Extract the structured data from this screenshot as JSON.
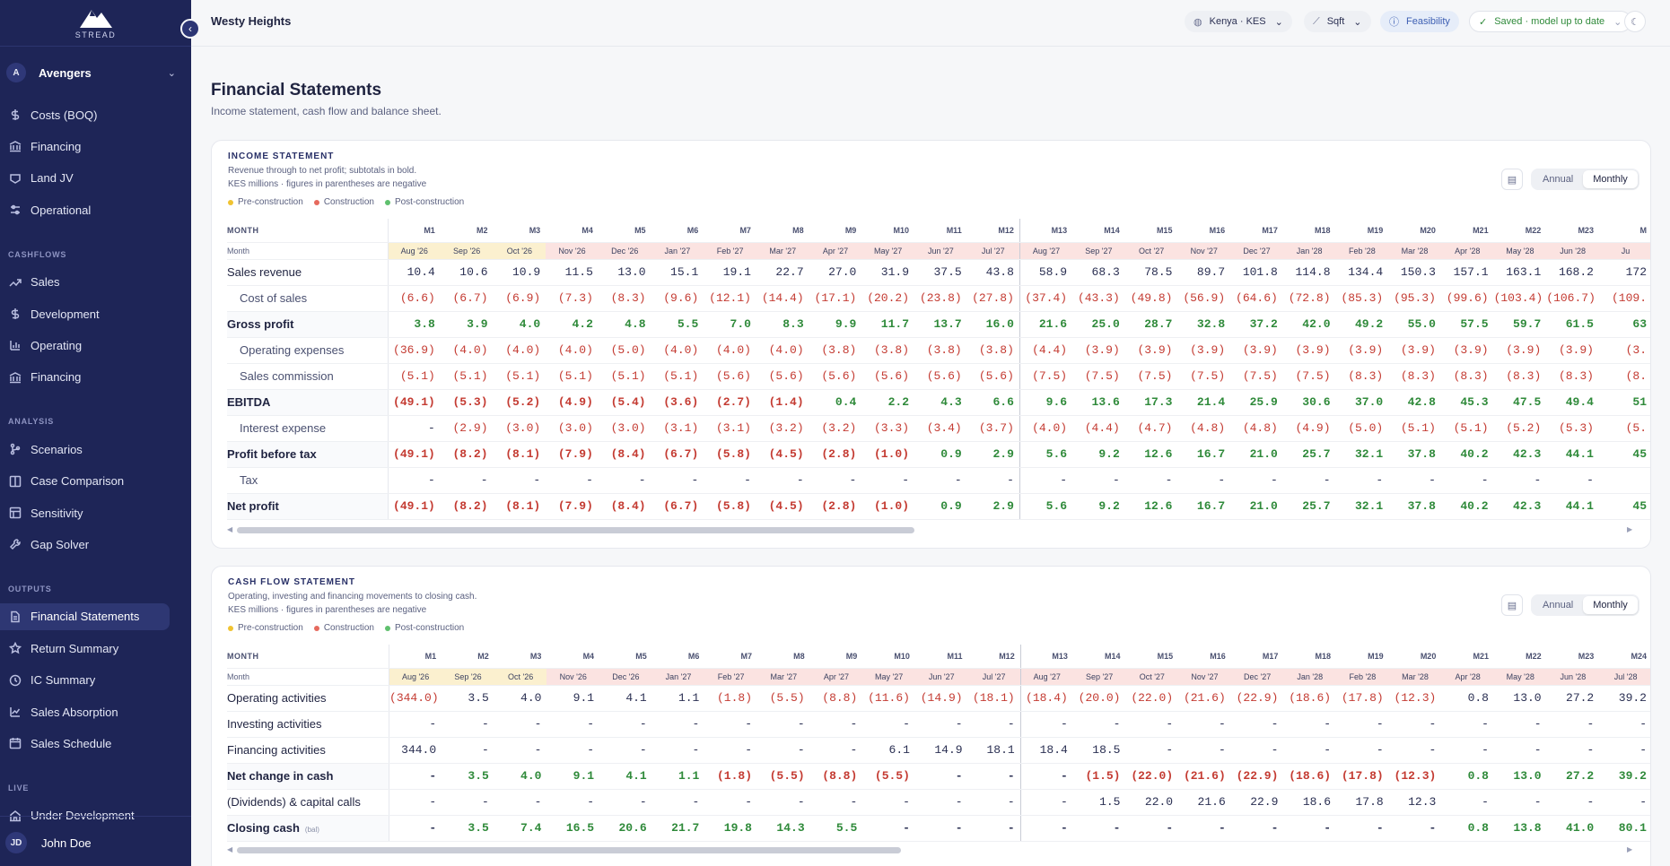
{
  "app": {
    "logo_text": "STREAD",
    "project_title": "Westy Heights"
  },
  "topbar": {
    "region": "Kenya · KES",
    "unit": "Sqft",
    "mode": "Feasibility",
    "status": "Saved · model up to date"
  },
  "sidebar": {
    "workspace_initial": "A",
    "workspace_name": "Avengers",
    "top_items": [
      {
        "label": "Costs (BOQ)",
        "icon": "dollar-icon"
      },
      {
        "label": "Financing",
        "icon": "bank-icon"
      },
      {
        "label": "Land JV",
        "icon": "handshake-icon"
      },
      {
        "label": "Operational",
        "icon": "sliders-icon"
      }
    ],
    "sections": [
      {
        "title": "CASHFLOWS",
        "items": [
          {
            "label": "Sales",
            "icon": "trend-icon"
          },
          {
            "label": "Development",
            "icon": "dollar-icon"
          },
          {
            "label": "Operating",
            "icon": "bar-chart-icon"
          },
          {
            "label": "Financing",
            "icon": "bank-icon"
          }
        ]
      },
      {
        "title": "ANALYSIS",
        "items": [
          {
            "label": "Scenarios",
            "icon": "branch-icon"
          },
          {
            "label": "Case Comparison",
            "icon": "columns-icon"
          },
          {
            "label": "Sensitivity",
            "icon": "table-icon"
          },
          {
            "label": "Gap Solver",
            "icon": "wrench-icon"
          }
        ]
      },
      {
        "title": "OUTPUTS",
        "items": [
          {
            "label": "Financial Statements",
            "icon": "document-icon",
            "active": true
          },
          {
            "label": "Return Summary",
            "icon": "star-icon"
          },
          {
            "label": "IC Summary",
            "icon": "clock-icon"
          },
          {
            "label": "Sales Absorption",
            "icon": "line-chart-icon"
          },
          {
            "label": "Sales Schedule",
            "icon": "calendar-icon"
          }
        ]
      },
      {
        "title": "LIVE",
        "items": [
          {
            "label": "Under Development",
            "icon": "building-icon"
          }
        ]
      }
    ],
    "user_initials": "JD",
    "user_name": "John Doe"
  },
  "page": {
    "title": "Financial Statements",
    "subtitle": "Income statement, cash flow and balance sheet."
  },
  "legend": {
    "pre": "Pre-construction",
    "con": "Construction",
    "post": "Post-construction"
  },
  "phase_colors": {
    "pre": "#f0c331",
    "con": "#e66a5e",
    "post": "#5fc06e"
  },
  "view_toggle": {
    "annual": "Annual",
    "monthly": "Monthly"
  },
  "income": {
    "title": "INCOME STATEMENT",
    "desc1": "Revenue through to net profit; subtotals in bold.",
    "desc2": "KES millions · figures in parentheses are negative",
    "header_label": "MONTH",
    "month_label": "Month",
    "months": [
      "M1",
      "M2",
      "M3",
      "M4",
      "M5",
      "M6",
      "M7",
      "M8",
      "M9",
      "M10",
      "M11",
      "M12",
      "M13",
      "M14",
      "M15",
      "M16",
      "M17",
      "M18",
      "M19",
      "M20",
      "M21",
      "M22",
      "M23",
      "M"
    ],
    "dates": [
      "Aug '26",
      "Sep '26",
      "Oct '26",
      "Nov '26",
      "Dec '26",
      "Jan '27",
      "Feb '27",
      "Mar '27",
      "Apr '27",
      "May '27",
      "Jun '27",
      "Jul '27",
      "Aug '27",
      "Sep '27",
      "Oct '27",
      "Nov '27",
      "Dec '27",
      "Jan '28",
      "Feb '28",
      "Mar '28",
      "Apr '28",
      "May '28",
      "Jun '28",
      "Ju"
    ],
    "phases": [
      "pre",
      "pre",
      "pre",
      "con",
      "con",
      "con",
      "con",
      "con",
      "con",
      "con",
      "con",
      "con",
      "con",
      "con",
      "con",
      "con",
      "con",
      "con",
      "con",
      "con",
      "con",
      "con",
      "con",
      "con"
    ],
    "rows": [
      {
        "label": "Sales revenue",
        "style": "plain",
        "values": [
          "10.4",
          "10.6",
          "10.9",
          "11.5",
          "13.0",
          "15.1",
          "19.1",
          "22.7",
          "27.0",
          "31.9",
          "37.5",
          "43.8",
          "58.9",
          "68.3",
          "78.5",
          "89.7",
          "101.8",
          "114.8",
          "134.4",
          "150.3",
          "157.1",
          "163.1",
          "168.2",
          "172"
        ]
      },
      {
        "label": "Cost of sales",
        "style": "indent",
        "values": [
          "(6.6)",
          "(6.7)",
          "(6.9)",
          "(7.3)",
          "(8.3)",
          "(9.6)",
          "(12.1)",
          "(14.4)",
          "(17.1)",
          "(20.2)",
          "(23.8)",
          "(27.8)",
          "(37.4)",
          "(43.3)",
          "(49.8)",
          "(56.9)",
          "(64.6)",
          "(72.8)",
          "(85.3)",
          "(95.3)",
          "(99.6)",
          "(103.4)",
          "(106.7)",
          "(109."
        ]
      },
      {
        "label": "Gross profit",
        "style": "bold",
        "values": [
          "3.8",
          "3.9",
          "4.0",
          "4.2",
          "4.8",
          "5.5",
          "7.0",
          "8.3",
          "9.9",
          "11.7",
          "13.7",
          "16.0",
          "21.6",
          "25.0",
          "28.7",
          "32.8",
          "37.2",
          "42.0",
          "49.2",
          "55.0",
          "57.5",
          "59.7",
          "61.5",
          "63"
        ]
      },
      {
        "label": "Operating expenses",
        "style": "indent",
        "values": [
          "(36.9)",
          "(4.0)",
          "(4.0)",
          "(4.0)",
          "(5.0)",
          "(4.0)",
          "(4.0)",
          "(4.0)",
          "(3.8)",
          "(3.8)",
          "(3.8)",
          "(3.8)",
          "(4.4)",
          "(3.9)",
          "(3.9)",
          "(3.9)",
          "(3.9)",
          "(3.9)",
          "(3.9)",
          "(3.9)",
          "(3.9)",
          "(3.9)",
          "(3.9)",
          "(3."
        ]
      },
      {
        "label": "Sales commission",
        "style": "indent",
        "values": [
          "(5.1)",
          "(5.1)",
          "(5.1)",
          "(5.1)",
          "(5.1)",
          "(5.1)",
          "(5.6)",
          "(5.6)",
          "(5.6)",
          "(5.6)",
          "(5.6)",
          "(5.6)",
          "(7.5)",
          "(7.5)",
          "(7.5)",
          "(7.5)",
          "(7.5)",
          "(7.5)",
          "(8.3)",
          "(8.3)",
          "(8.3)",
          "(8.3)",
          "(8.3)",
          "(8."
        ]
      },
      {
        "label": "EBITDA",
        "style": "bold",
        "values": [
          "(49.1)",
          "(5.3)",
          "(5.2)",
          "(4.9)",
          "(5.4)",
          "(3.6)",
          "(2.7)",
          "(1.4)",
          "0.4",
          "2.2",
          "4.3",
          "6.6",
          "9.6",
          "13.6",
          "17.3",
          "21.4",
          "25.9",
          "30.6",
          "37.0",
          "42.8",
          "45.3",
          "47.5",
          "49.4",
          "51"
        ]
      },
      {
        "label": "Interest expense",
        "style": "indent",
        "values": [
          "-",
          "(2.9)",
          "(3.0)",
          "(3.0)",
          "(3.0)",
          "(3.1)",
          "(3.1)",
          "(3.2)",
          "(3.2)",
          "(3.3)",
          "(3.4)",
          "(3.7)",
          "(4.0)",
          "(4.4)",
          "(4.7)",
          "(4.8)",
          "(4.8)",
          "(4.9)",
          "(5.0)",
          "(5.1)",
          "(5.1)",
          "(5.2)",
          "(5.3)",
          "(5."
        ]
      },
      {
        "label": "Profit before tax",
        "style": "bold",
        "values": [
          "(49.1)",
          "(8.2)",
          "(8.1)",
          "(7.9)",
          "(8.4)",
          "(6.7)",
          "(5.8)",
          "(4.5)",
          "(2.8)",
          "(1.0)",
          "0.9",
          "2.9",
          "5.6",
          "9.2",
          "12.6",
          "16.7",
          "21.0",
          "25.7",
          "32.1",
          "37.8",
          "40.2",
          "42.3",
          "44.1",
          "45"
        ]
      },
      {
        "label": "Tax",
        "style": "indent",
        "values": [
          "-",
          "-",
          "-",
          "-",
          "-",
          "-",
          "-",
          "-",
          "-",
          "-",
          "-",
          "-",
          "-",
          "-",
          "-",
          "-",
          "-",
          "-",
          "-",
          "-",
          "-",
          "-",
          "-",
          ""
        ]
      },
      {
        "label": "Net profit",
        "style": "bold",
        "values": [
          "(49.1)",
          "(8.2)",
          "(8.1)",
          "(7.9)",
          "(8.4)",
          "(6.7)",
          "(5.8)",
          "(4.5)",
          "(2.8)",
          "(1.0)",
          "0.9",
          "2.9",
          "5.6",
          "9.2",
          "12.6",
          "16.7",
          "21.0",
          "25.7",
          "32.1",
          "37.8",
          "40.2",
          "42.3",
          "44.1",
          "45"
        ]
      }
    ]
  },
  "cashflow": {
    "title": "CASH FLOW STATEMENT",
    "desc1": "Operating, investing and financing movements to closing cash.",
    "desc2": "KES millions · figures in parentheses are negative",
    "header_label": "MONTH",
    "month_label": "Month",
    "months": [
      "M1",
      "M2",
      "M3",
      "M4",
      "M5",
      "M6",
      "M7",
      "M8",
      "M9",
      "M10",
      "M11",
      "M12",
      "M13",
      "M14",
      "M15",
      "M16",
      "M17",
      "M18",
      "M19",
      "M20",
      "M21",
      "M22",
      "M23",
      "M24"
    ],
    "dates": [
      "Aug '26",
      "Sep '26",
      "Oct '26",
      "Nov '26",
      "Dec '26",
      "Jan '27",
      "Feb '27",
      "Mar '27",
      "Apr '27",
      "May '27",
      "Jun '27",
      "Jul '27",
      "Aug '27",
      "Sep '27",
      "Oct '27",
      "Nov '27",
      "Dec '27",
      "Jan '28",
      "Feb '28",
      "Mar '28",
      "Apr '28",
      "May '28",
      "Jun '28",
      "Jul '28"
    ],
    "phases": [
      "pre",
      "pre",
      "pre",
      "con",
      "con",
      "con",
      "con",
      "con",
      "con",
      "con",
      "con",
      "con",
      "con",
      "con",
      "con",
      "con",
      "con",
      "con",
      "con",
      "con",
      "con",
      "con",
      "con",
      "con"
    ],
    "rows": [
      {
        "label": "Operating activities",
        "style": "plain",
        "values": [
          "(344.0)",
          "3.5",
          "4.0",
          "9.1",
          "4.1",
          "1.1",
          "(1.8)",
          "(5.5)",
          "(8.8)",
          "(11.6)",
          "(14.9)",
          "(18.1)",
          "(18.4)",
          "(20.0)",
          "(22.0)",
          "(21.6)",
          "(22.9)",
          "(18.6)",
          "(17.8)",
          "(12.3)",
          "0.8",
          "13.0",
          "27.2",
          "39.2"
        ]
      },
      {
        "label": "Investing activities",
        "style": "plain",
        "values": [
          "-",
          "-",
          "-",
          "-",
          "-",
          "-",
          "-",
          "-",
          "-",
          "-",
          "-",
          "-",
          "-",
          "-",
          "-",
          "-",
          "-",
          "-",
          "-",
          "-",
          "-",
          "-",
          "-",
          "-"
        ]
      },
      {
        "label": "Financing activities",
        "style": "plain",
        "values": [
          "344.0",
          "-",
          "-",
          "-",
          "-",
          "-",
          "-",
          "-",
          "-",
          "6.1",
          "14.9",
          "18.1",
          "18.4",
          "18.5",
          "-",
          "-",
          "-",
          "-",
          "-",
          "-",
          "-",
          "-",
          "-",
          "-"
        ]
      },
      {
        "label": "Net change in cash",
        "style": "bold",
        "values": [
          "-",
          "3.5",
          "4.0",
          "9.1",
          "4.1",
          "1.1",
          "(1.8)",
          "(5.5)",
          "(8.8)",
          "(5.5)",
          "-",
          "-",
          "-",
          "(1.5)",
          "(22.0)",
          "(21.6)",
          "(22.9)",
          "(18.6)",
          "(17.8)",
          "(12.3)",
          "0.8",
          "13.0",
          "27.2",
          "39.2"
        ]
      },
      {
        "label": "(Dividends) & capital calls",
        "style": "plain",
        "values": [
          "-",
          "-",
          "-",
          "-",
          "-",
          "-",
          "-",
          "-",
          "-",
          "-",
          "-",
          "-",
          "-",
          "1.5",
          "22.0",
          "21.6",
          "22.9",
          "18.6",
          "17.8",
          "12.3",
          "-",
          "-",
          "-",
          "-"
        ]
      },
      {
        "label": "Closing cash",
        "tag": "(bal)",
        "style": "bold",
        "values": [
          "-",
          "3.5",
          "7.4",
          "16.5",
          "20.6",
          "21.7",
          "19.8",
          "14.3",
          "5.5",
          "-",
          "-",
          "-",
          "-",
          "-",
          "-",
          "-",
          "-",
          "-",
          "-",
          "-",
          "0.8",
          "13.8",
          "41.0",
          "80.1"
        ]
      }
    ]
  }
}
